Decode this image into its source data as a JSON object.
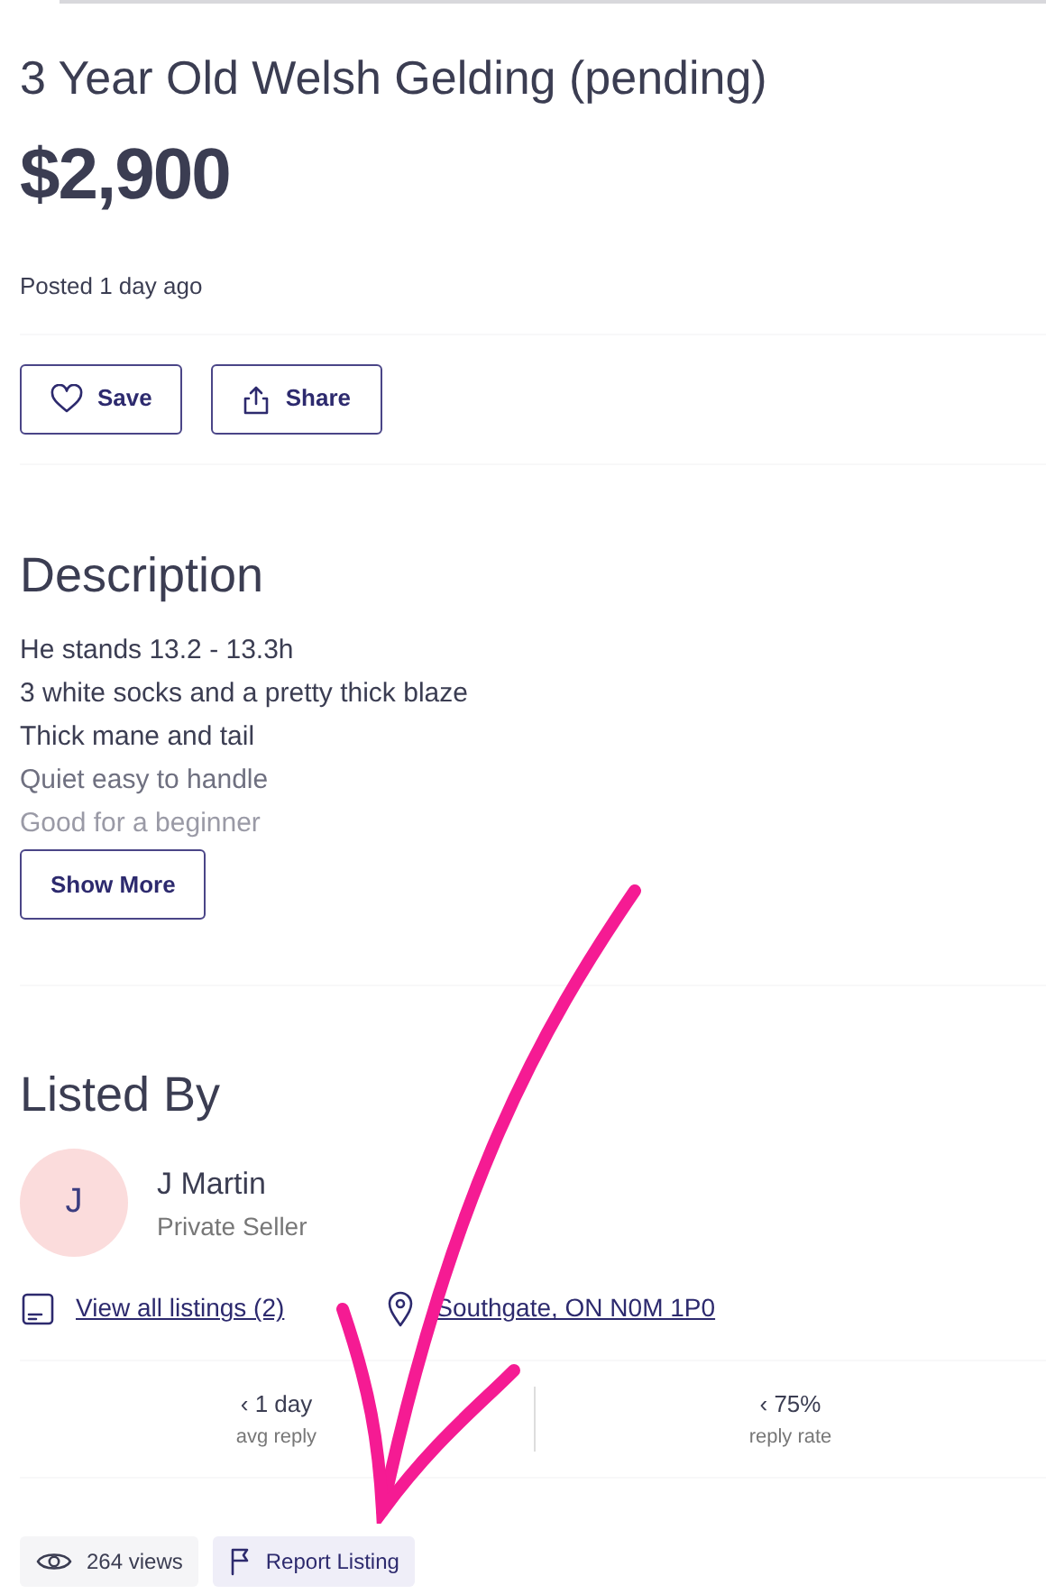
{
  "listing": {
    "title": "3 Year Old Welsh Gelding (pending)",
    "price": "$2,900",
    "posted": "Posted 1 day ago"
  },
  "actions": [
    {
      "kind": "save",
      "label": "Save"
    },
    {
      "kind": "share",
      "label": "Share"
    }
  ],
  "description": {
    "heading": "Description",
    "lines": [
      "He stands 13.2 - 13.3h",
      "3 white socks and a pretty thick blaze",
      "Thick mane and tail",
      "Quiet easy to handle",
      "Good for a beginner"
    ],
    "button": "Show More"
  },
  "seller": {
    "heading": "Listed By",
    "initial": "J",
    "name": "J Martin",
    "type": "Private Seller",
    "listings_link": "View all listings (2)",
    "location_link": "Southgate, ON N0M 1P0"
  },
  "stats": [
    {
      "value": "‹ 1 day",
      "label": "avg reply"
    },
    {
      "value": "‹ 75%",
      "label": "reply rate"
    }
  ],
  "footer": {
    "views": "264 views",
    "report": "Report Listing"
  }
}
